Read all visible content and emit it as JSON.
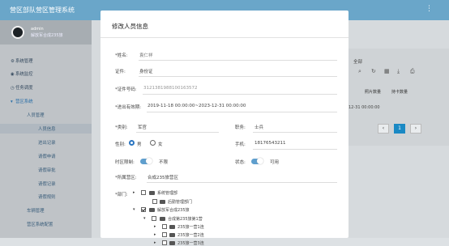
{
  "app": {
    "title": "营区部队营区管理系统",
    "menu_icon": "⋮"
  },
  "user": {
    "name": "admin",
    "org": "解放军合成235旅"
  },
  "sidebar": {
    "items": [
      {
        "label": "系统管理",
        "icon": "gear-icon"
      },
      {
        "label": "系统监控",
        "icon": "monitor-icon"
      },
      {
        "label": "任务调度",
        "icon": "clock-icon"
      },
      {
        "label": "营区系统",
        "icon": "shield-icon"
      }
    ],
    "sub": [
      {
        "label": "人员管理"
      }
    ],
    "sub2": [
      {
        "label": "人员信息"
      },
      {
        "label": "进出记录"
      },
      {
        "label": "请假申请"
      },
      {
        "label": "请假审批"
      },
      {
        "label": "请假记录"
      },
      {
        "label": "请假规则"
      }
    ],
    "more": [
      {
        "label": "车辆管理"
      },
      {
        "label": "营区系统配置"
      }
    ]
  },
  "background": {
    "label": "全部",
    "cols": [
      "照片数量",
      "持卡数量"
    ],
    "row": "12-31 00:00:00",
    "pager": [
      "‹",
      "1",
      "›"
    ]
  },
  "modal": {
    "title": "修改人员信息",
    "name_label": "*姓名:",
    "name_value": "袁仁祥",
    "cert_label": "证件:",
    "cert_value": "身份证",
    "certno_label": "*证件号码:",
    "certno_value": "3121381988100163572",
    "valid_label": "*进出有效期:",
    "valid_value": "2019-11-18 00:00:00~2023-12-31 00:00:00",
    "type_label": "*类别:",
    "type_value": "军官",
    "duty_label": "职务:",
    "duty_value": "士兵",
    "gender_label": "性别:",
    "gender_male": "男",
    "gender_female": "女",
    "phone_label": "手机:",
    "phone_value": "18176543211",
    "timelimit_label": "时区限制:",
    "timelimit_value": "不限",
    "status_label": "状态:",
    "status_value": "可用",
    "camp_label": "*所属营区:",
    "camp_value": "合成235旅营区",
    "dept_label": "*部门:",
    "tree": [
      {
        "label": "系统管理部",
        "checked": false
      },
      {
        "label": "后勤管理部门",
        "checked": false
      },
      {
        "label": "解放军合成235旅",
        "checked": true
      },
      {
        "label": "合成第235旅第1营",
        "checked": false
      },
      {
        "label": "235旅一营1连",
        "checked": false
      },
      {
        "label": "235旅一营2连",
        "checked": false
      },
      {
        "label": "235旅一营3连",
        "checked": false
      }
    ]
  }
}
